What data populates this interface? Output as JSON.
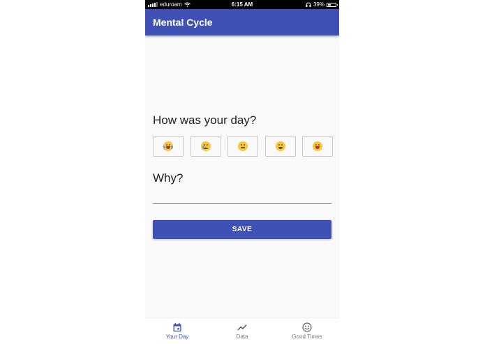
{
  "status_bar": {
    "carrier": "eduroam",
    "time": "6:15 AM",
    "battery": "39%",
    "battery_level": 0.39
  },
  "app_bar": {
    "title": "Mental Cycle"
  },
  "mood_section": {
    "question": "How was your day?",
    "options": [
      {
        "icon": "crying-face-icon"
      },
      {
        "icon": "sad-tear-face-icon"
      },
      {
        "icon": "neutral-face-icon"
      },
      {
        "icon": "smiling-face-icon"
      },
      {
        "icon": "star-struck-face-icon"
      }
    ]
  },
  "reason_section": {
    "label": "Why?",
    "value": ""
  },
  "save_button": {
    "label": "SAVE"
  },
  "bottom_nav": {
    "items": [
      {
        "label": "Your Day",
        "icon": "calendar-icon",
        "active": true
      },
      {
        "label": "Data",
        "icon": "trending-line-icon",
        "active": false
      },
      {
        "label": "Good Times",
        "icon": "smile-icon",
        "active": false
      }
    ]
  },
  "colors": {
    "primary": "#3f51b5",
    "background": "#fafafa",
    "status_bar": "#000000"
  }
}
